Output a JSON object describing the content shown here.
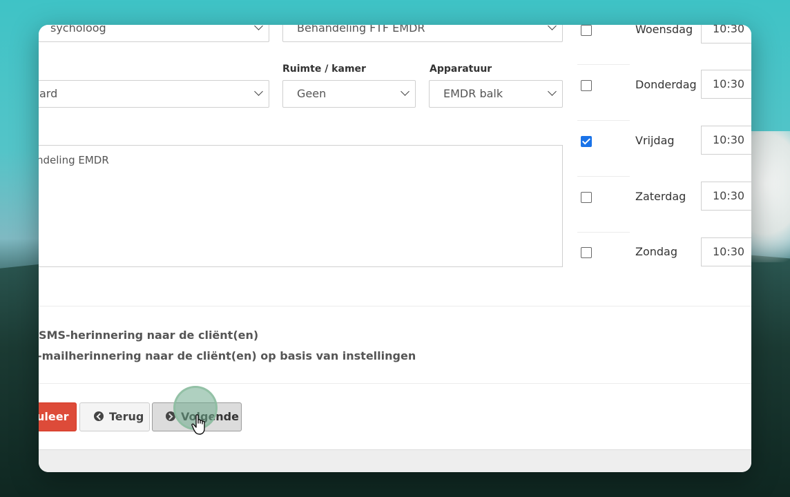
{
  "form": {
    "behandelaar_value": "sycholoog",
    "activiteit_value": "Behandeling FTF EMDR",
    "type_value": "ard",
    "ruimte_label": "Ruimte / kamer",
    "ruimte_value": "Geen",
    "apparatuur_label": "Apparatuur",
    "apparatuur_value": "EMDR balk",
    "notes_value": "ndeling EMDR"
  },
  "days": [
    {
      "label": "Woensdag",
      "checked": false,
      "time": "10:30"
    },
    {
      "label": "Donderdag",
      "checked": false,
      "time": "10:30"
    },
    {
      "label": "Vrijdag",
      "checked": true,
      "time": "10:30"
    },
    {
      "label": "Zaterdag",
      "checked": false,
      "time": "10:30"
    },
    {
      "label": "Zondag",
      "checked": false,
      "time": "10:30"
    }
  ],
  "options": {
    "sms": "SMS-herinnering naar de cliënt(en)",
    "email": "-mailherinnering naar de cliënt(en) op basis van instellingen"
  },
  "buttons": {
    "cancel": "uleer",
    "back": "Terug",
    "next": "Volgende"
  },
  "colors": {
    "danger": "#dd4b39",
    "checkbox_checked": "#1a73e8"
  }
}
